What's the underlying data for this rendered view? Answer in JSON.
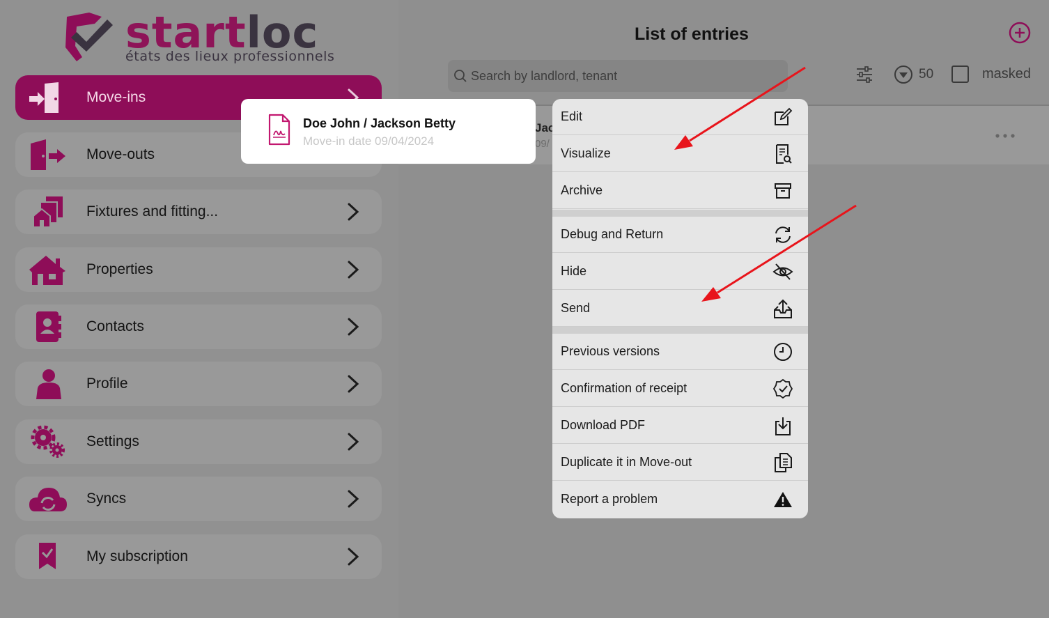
{
  "logo": {
    "word_start": "start",
    "word_end": "loc",
    "tagline": "états des lieux professionnels"
  },
  "sidebar": {
    "items": [
      {
        "label": "Move-ins",
        "icon": "door-in-icon",
        "active": true
      },
      {
        "label": "Move-outs",
        "icon": "door-out-icon"
      },
      {
        "label": "Fixtures and fitting...",
        "icon": "building-stack-icon"
      },
      {
        "label": "Properties",
        "icon": "house-icon"
      },
      {
        "label": "Contacts",
        "icon": "contact-book-icon"
      },
      {
        "label": "Profile",
        "icon": "person-icon"
      },
      {
        "label": "Settings",
        "icon": "gears-icon"
      },
      {
        "label": "Syncs",
        "icon": "cloud-sync-icon"
      },
      {
        "label": "My subscription",
        "icon": "bookmark-check-icon"
      }
    ]
  },
  "header": {
    "title": "List of entries",
    "search_placeholder": "Search by landlord, tenant",
    "count": "50",
    "masked_label": "masked"
  },
  "list": {
    "row_partial_name": "Jac",
    "row_partial_date": "09/"
  },
  "entry_card": {
    "name": "Doe John  / Jackson Betty",
    "date": "Move-in date 09/04/2024"
  },
  "menu": {
    "items": [
      {
        "label": "Edit",
        "icon": "edit-icon"
      },
      {
        "label": "Visualize",
        "icon": "document-search-icon"
      },
      {
        "label": "Archive",
        "icon": "archive-icon"
      },
      {
        "label": "Debug and Return",
        "icon": "refresh-icon"
      },
      {
        "label": "Hide",
        "icon": "eye-off-icon"
      },
      {
        "label": "Send",
        "icon": "upload-tray-icon"
      },
      {
        "label": "Previous versions",
        "icon": "clock-icon"
      },
      {
        "label": "Confirmation of receipt",
        "icon": "badge-check-icon"
      },
      {
        "label": "Download PDF",
        "icon": "download-icon"
      },
      {
        "label": "Duplicate it in Move-out",
        "icon": "copy-icon"
      },
      {
        "label": "Report a problem",
        "icon": "warning-icon"
      }
    ]
  },
  "colors": {
    "brand": "#8e0d58",
    "brand_bright": "#c2176f",
    "dark_text": "#3a3340",
    "annotation_arrow": "#e8141b"
  }
}
